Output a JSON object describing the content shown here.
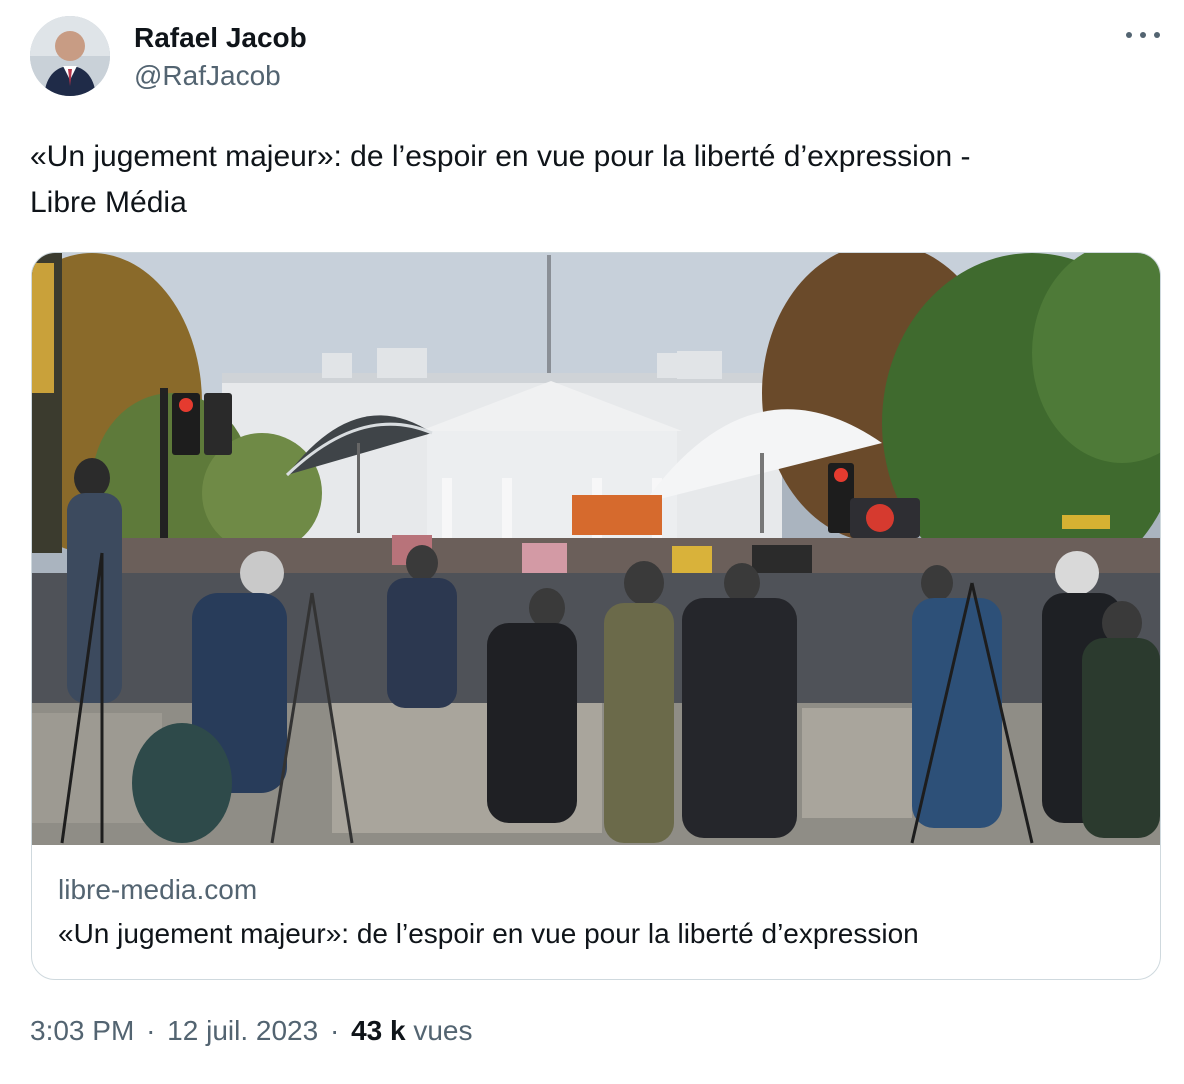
{
  "author": {
    "name": "Rafael Jacob",
    "handle": "@RafJacob"
  },
  "tweet": {
    "text_line1": "«Un jugement majeur»: de l’espoir en vue pour la liberté d’expression -",
    "text_line2": "Libre Média"
  },
  "card": {
    "domain": "libre-media.com",
    "title": "«Un jugement majeur»: de l’espoir en vue pour la liberté d’expression",
    "image_description_icon": "photo-white-house-protest-press"
  },
  "meta": {
    "time": "3:03 PM",
    "separator": "·",
    "date": "12 juil. 2023",
    "views_count": "43 k",
    "views_label": "vues"
  },
  "colors": {
    "text_primary": "#0f1419",
    "text_secondary": "#536471",
    "border": "#cfd9de"
  }
}
